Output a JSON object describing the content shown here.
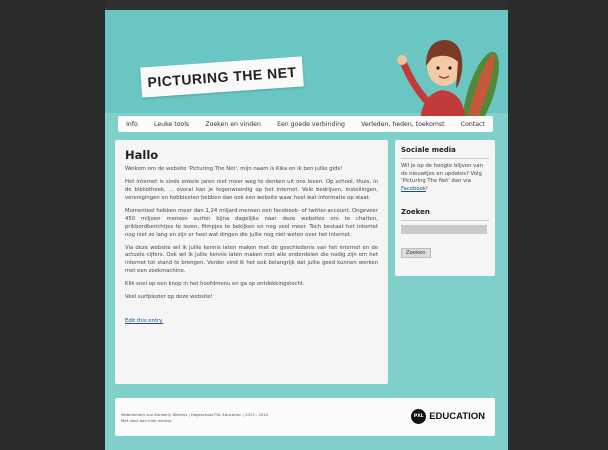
{
  "site": {
    "title": "PICTURING THE NET"
  },
  "nav": {
    "items": [
      "Info",
      "Leuke tools",
      "Zoeken en vinden",
      "Een goede verbinding",
      "Verleden, heden, toekomst",
      "Contact"
    ]
  },
  "main": {
    "heading": "Hallo",
    "paragraphs": [
      "Welkom om de website 'Picturing The Net', mijn naam is Kika en ik ben jullie gids!",
      "Het internet is sinds enkele jaren niet meer weg te denken uit ons leven. Op school, thuis, in de bibliotheek, ... overal kan je tegenwoordig op het internet. Vele bedrijven, instellingen, verenigingen en hobbiesten hebben dan ook een website waar heel wat informatie op staat.",
      "Momenteel hebben meer dan 1,24 miljard mensen een facebook- of twitter-account. Ongeveer 450 miljoen mensen surfen bijna dagelijks naar deze websites om te chatten, prikbordberichtjes te lezen, filmpjes te bekijken en nog veel meer. Toch bestaat het internet nog niet zo lang en zijn er heel wat dingen die jullie nog niet weten over het internet.",
      "Via deze website wil ik jullie kennis laten maken met de geschiedenis van het internet en de actuele cijfers. Ook wil ik jullie kennis laten maken met alle onderdelen die nodig zijn om het internet tot stand te brengen. Verder vind ik het ook belangrijk dat jullie goed kunnen werken met een zoekmachine.",
      "Klik snel op een knop in het hoofdmenu en ga op ontdekkingstocht.",
      "Veel surfplezier op deze website!"
    ],
    "edit_link": "Edit this entry."
  },
  "sidebar": {
    "social": {
      "heading": "Sociale media",
      "text": "Wil je op de hoogte blijven van de nieuwtjes en updates? Volg 'Picturing The Net' dan via",
      "link": "Facebook",
      "suffix": "!"
    },
    "search": {
      "heading": "Zoeken",
      "placeholder": "",
      "button": "Zoeken"
    }
  },
  "footer": {
    "line1": "Webelement van Kimberly Willems | Hogeschool PXL Education | 2013 - 2014",
    "line2": "Met dank aan mijn mentor.",
    "logo_badge": "PXL",
    "logo_text": "EDUCATION"
  },
  "colors": {
    "background": "#7fcfcb",
    "panel": "#f5f5f5",
    "link": "#1b4f87"
  }
}
